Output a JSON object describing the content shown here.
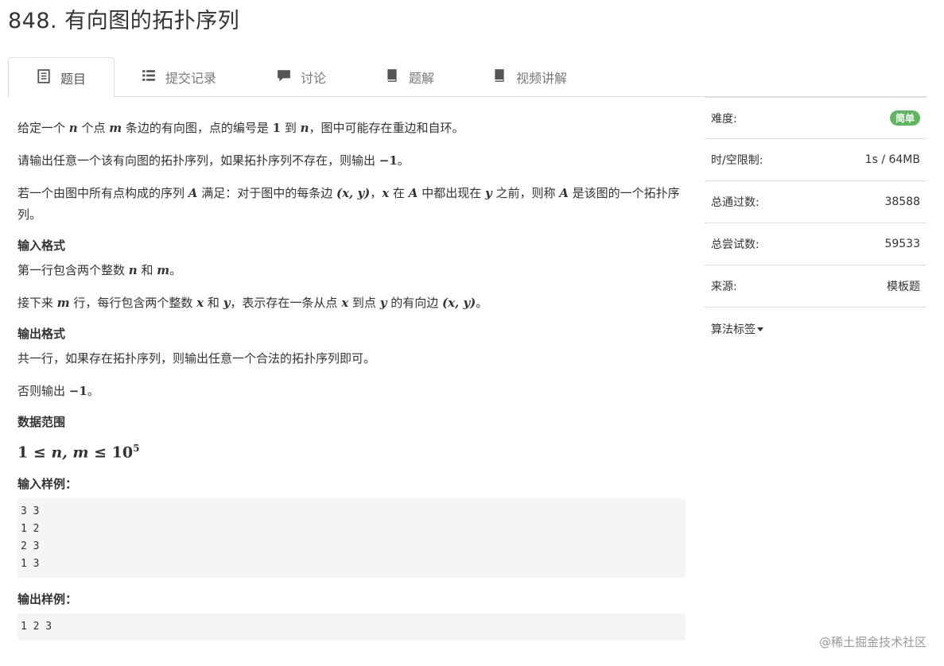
{
  "problem": {
    "title": "848. 有向图的拓扑序列"
  },
  "tabs": [
    {
      "label": "题目",
      "icon": "document-icon",
      "active": true
    },
    {
      "label": "提交记录",
      "icon": "list-icon"
    },
    {
      "label": "讨论",
      "icon": "comment-icon"
    },
    {
      "label": "题解",
      "icon": "book-icon"
    },
    {
      "label": "视频讲解",
      "icon": "book-icon"
    }
  ],
  "description": {
    "p1": {
      "a": "给定一个 ",
      "n": "n",
      "b": " 个点 ",
      "m": "m",
      "c": " 条边的有向图，点的编号是 ",
      "one": "1",
      "d": " 到 ",
      "n2": "n",
      "e": "，图中可能存在重边和自环。"
    },
    "p2": {
      "a": "请输出任意一个该有向图的拓扑序列，如果拓扑序列不存在，则输出 ",
      "neg": "−1",
      "b": "。"
    },
    "p3": {
      "a": "若一个由图中所有点构成的序列 ",
      "A": "A",
      "b": " 满足：对于图中的每条边 ",
      "xy": "(x, y)",
      "c": "，",
      "x": "x",
      "d": " 在 ",
      "A2": "A",
      "e": " 中都出现在 ",
      "y": "y",
      "f": " 之前，则称 ",
      "A3": "A",
      "g": " 是该图的一个拓扑序列。"
    },
    "input_heading": "输入格式",
    "p4": {
      "a": "第一行包含两个整数 ",
      "n": "n",
      "b": " 和 ",
      "m": "m",
      "c": "。"
    },
    "p5": {
      "a": "接下来 ",
      "m": "m",
      "b": " 行，每行包含两个整数 ",
      "x": "x",
      "c": " 和 ",
      "y": "y",
      "d": "，表示存在一条从点 ",
      "x2": "x",
      "e": " 到点 ",
      "y2": "y",
      "f": " 的有向边 ",
      "xy": "(x, y)",
      "g": "。"
    },
    "output_heading": "输出格式",
    "p6": "共一行，如果存在拓扑序列，则输出任意一个合法的拓扑序列即可。",
    "p7": {
      "a": "否则输出 ",
      "neg": "−1",
      "b": "。"
    },
    "range_heading": "数据范围",
    "range": {
      "a": "1 ≤ ",
      "nm": "n, m",
      "b": " ≤ 10",
      "exp": "5"
    },
    "sample_in_heading": "输入样例：",
    "sample_in": "3 3\n1 2\n2 3\n1 3",
    "sample_out_heading": "输出样例：",
    "sample_out": "1 2 3"
  },
  "sidebar": {
    "difficulty_label": "难度:",
    "difficulty_value": "简单",
    "limit_label": "时/空限制:",
    "limit_value": "1s / 64MB",
    "passed_label": "总通过数:",
    "passed_value": "38588",
    "attempts_label": "总尝试数:",
    "attempts_value": "59533",
    "source_label": "来源:",
    "source_value": "模板题",
    "tags_label": "算法标签"
  },
  "watermark": "@稀土掘金技术社区",
  "colors": {
    "badge": "#5cb85c",
    "border": "#dddddd",
    "code_bg": "#f5f5f5"
  }
}
